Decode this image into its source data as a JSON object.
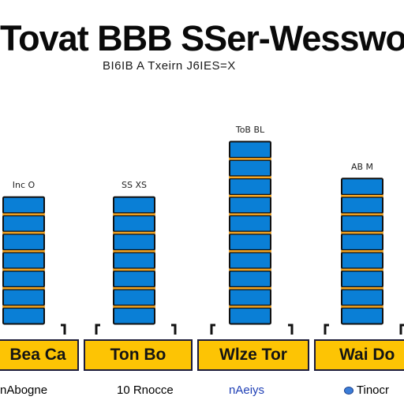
{
  "chart_data": {
    "type": "bar",
    "title": "Tovat BBB SSer-Wesswo",
    "subtitle": "BI6IB  A Txeirn  J6IES=X",
    "categories": [
      "Bea Ca",
      "Ton Bo",
      "Wlze Tor",
      "Wai Do"
    ],
    "values": [
      7,
      7,
      10,
      8
    ],
    "value_labels": [
      "Inc O",
      "SS XS",
      "ToB BL",
      "AB M"
    ],
    "legend": [
      {
        "label": "nAbogne",
        "color": "#1a1a1a"
      },
      {
        "label": "10 Rnocce",
        "color": "#1a1a1a",
        "marker_color": "#f5a30a"
      },
      {
        "label": "nAeiys",
        "color": "#1f3fb5"
      },
      {
        "label": "Tinocr",
        "color": "#1a1a1a",
        "marker_color": "#3b7dd8"
      }
    ],
    "ylim": [
      0,
      10
    ],
    "xlabel": "",
    "ylabel": "",
    "grid": false,
    "colors": {
      "bar_fill": "#0a7fd6",
      "bar_border": "#111111",
      "segment_divider": "#f5a623",
      "category_box": "#fdc404"
    }
  }
}
